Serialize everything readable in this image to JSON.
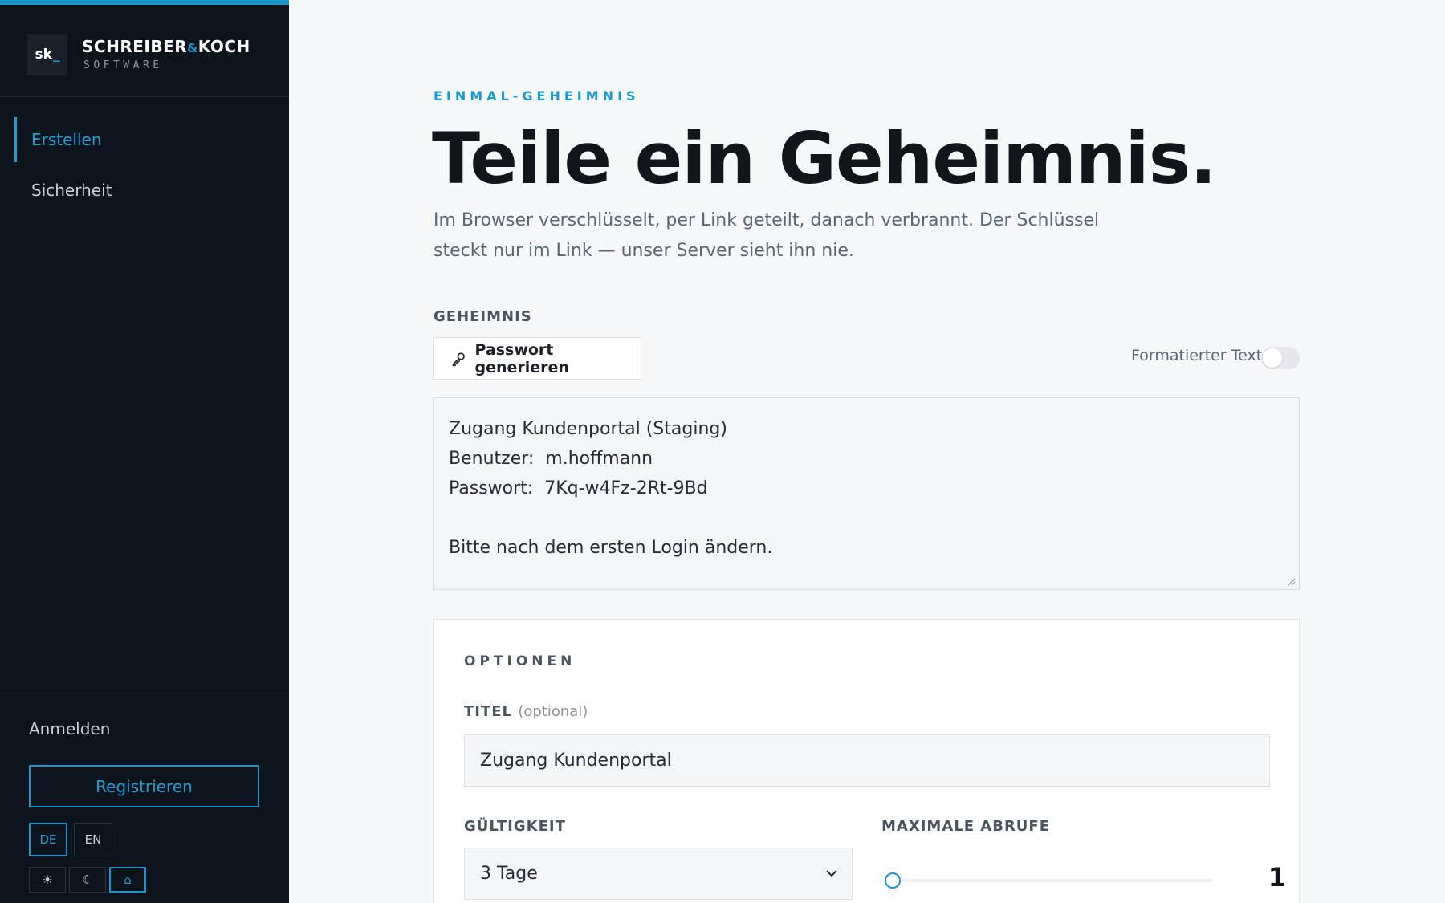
{
  "sidebar": {
    "brand": {
      "mark": "sk",
      "mark_cursor": "_",
      "name_part1": "SCHREIBER",
      "name_amp": "&",
      "name_part2": "KOCH",
      "subtitle": "SOFTWARE"
    },
    "nav": [
      {
        "label": "Erstellen",
        "active": true
      },
      {
        "label": "Sicherheit",
        "active": false
      }
    ],
    "login_label": "Anmelden",
    "register_label": "Registrieren",
    "languages": [
      {
        "code": "DE",
        "active": true
      },
      {
        "code": "EN",
        "active": false
      }
    ],
    "themes": [
      {
        "name": "sun-icon",
        "glyph": "☀",
        "active": false
      },
      {
        "name": "moon-icon",
        "glyph": "☾",
        "active": false
      },
      {
        "name": "home-icon",
        "glyph": "⌂",
        "active": true
      }
    ]
  },
  "main": {
    "eyebrow": "EINMAL-GEHEIMNIS",
    "title": "Teile ein Geheimnis.",
    "lede": "Im Browser verschlüsselt, per Link geteilt, danach verbrannt. Der Schlüssel steckt nur im Link — unser Server sieht ihn nie.",
    "secret_label": "GEHEIMNIS",
    "generate_button": "Passwort generieren",
    "formatted_text_label": "Formatierter Text",
    "formatted_text_enabled": false,
    "secret_lines": [
      "Zugang Kundenportal (Staging)",
      "Benutzer:  m.hoffmann",
      "Passwort:  7Kq-w4Fz-2Rt-9Bd",
      "",
      "Bitte nach dem ersten Login ändern."
    ],
    "options": {
      "title": "OPTIONEN",
      "title_label": "TITEL",
      "title_optional": "(optional)",
      "title_value": "Zugang Kundenportal",
      "validity_label": "GÜLTIGKEIT",
      "validity_value": "3 Tage",
      "max_views_label": "MAXIMALE ABRUFE",
      "max_views_value": "1",
      "max_views_fraction": 0.0
    }
  },
  "colors": {
    "accent": "#1b96cc",
    "sidebar_bg": "#0d141b",
    "page_bg": "#f6f7f9"
  }
}
